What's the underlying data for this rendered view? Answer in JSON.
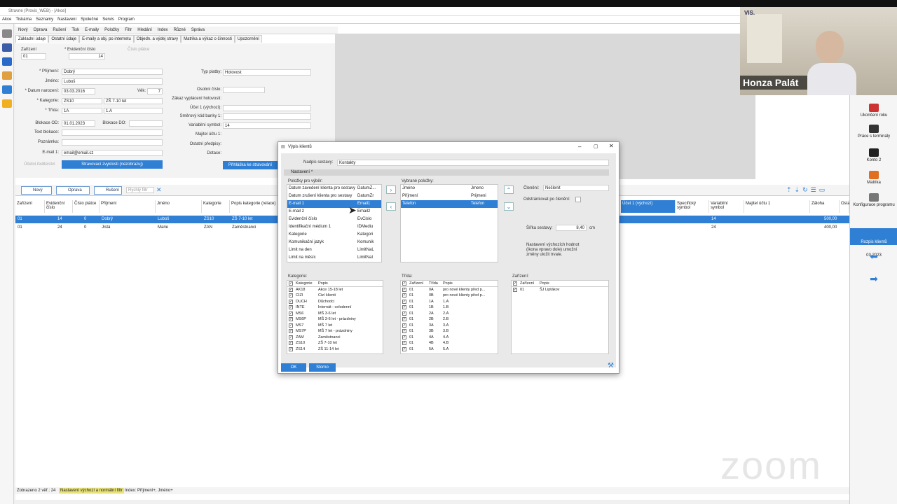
{
  "window": {
    "title": "Stravne (Provis_WEB) - [Akce]"
  },
  "menu": [
    "Akce",
    "Tiskárna",
    "Seznamy",
    "Nastavení",
    "Společné",
    "Servis",
    "Program"
  ],
  "commands": [
    "Nový",
    "Oprava",
    "Rušení",
    "Tisk",
    "E-maily",
    "Položky",
    "Filtr",
    "Hledání",
    "Index",
    "Různé",
    "Správa"
  ],
  "tabs": [
    "Základní údaje",
    "Ostatní údaje",
    "E-maily a obj. po internetu",
    "Objedn. a výdej stravy",
    "Matrika a výkaz o činnosti",
    "Upozornění"
  ],
  "form": {
    "zarizeni_label": "Zařízení",
    "zarizeni": "01",
    "evid_label": "* Evidenční číslo",
    "evid": "14",
    "cislo_platce": "Číslo plátce",
    "prijmeni_label": "* Příjmení:",
    "prijmeni": "Dobrý",
    "jmeno_label": "Jméno:",
    "jmeno": "Luboš",
    "datum_label": "* Datum narození:",
    "datum": "03.03.2016",
    "vek_label": "Věk:",
    "vek": "7",
    "kategorie_label": "* Kategorie:",
    "kategorie": "ZS10",
    "kategorie_popis": "ZŠ 7-10 let",
    "trida_label": "* Třída:",
    "trida": "1A",
    "trida_popis": "1.A",
    "blok_od_label": "Blokace OD:",
    "blok_od": "01.01.2023",
    "blok_do_label": "Blokace DO:",
    "text_blok_label": "Text blokace:",
    "poznamka_label": "Poznámka:",
    "email_label": "E-mail 1:",
    "email": "email@email.cz",
    "stravovaci_btn": "Stravovací zvyklosti (nezobrazuj)",
    "hidden_cb": "Účetní ředitelství",
    "typ_platby_label": "Typ platby:",
    "typ_platby": "Hotovost",
    "osobni_label": "Osobní číslo:",
    "zakaz_label": "Zákaz vyplácení hotovosti:",
    "ucet_label": "Účet 1 (výchozí):",
    "smerovy_label": "Směrový kód banky 1:",
    "var_label": "Variabilní symbol:",
    "var": "14",
    "majitel_label": "Majitel účtu 1:",
    "ostatni_label": "Ostatní předpisy:",
    "dotace_label": "Dotace:",
    "prihlaska_btn": "Přihláška ke stravování"
  },
  "rowbar": {
    "new": "Nový",
    "edit": "Oprava",
    "delete": "Rušení",
    "filter": "Rychlý filtr"
  },
  "grid": {
    "headers": [
      "Zařízení",
      "Evidenční číslo",
      "Číslo plátce",
      "Příjmení",
      "Jméno",
      "Kategorie",
      "Popis kategorie (relace)",
      "Účet 1 (výchozí)",
      "Specifický symbol",
      "Variabilní symbol",
      "Majitel účtu 1",
      "Záloha",
      "Ostatní"
    ],
    "rows": [
      [
        "01",
        "14",
        "0",
        "Dobrý",
        "Luboš",
        "ZS10",
        "ZŠ 7-10 let",
        "14",
        "500,00"
      ],
      [
        "01",
        "24",
        "0",
        "Jistá",
        "Marie",
        "ZAN",
        "Zaměstnanci",
        "24",
        "400,00"
      ]
    ]
  },
  "status": {
    "count": "Zobrazeno 2 věř.: 24",
    "filter": "Nastavení výchozí a normální filtr",
    "index": "Index: Příjmení+, Jméno+"
  },
  "camera": {
    "name": "Honza Palát",
    "brand": "VIS."
  },
  "rightpanel": [
    {
      "label": "Ukončení roku"
    },
    {
      "label": "Práce s terminály"
    },
    {
      "label": "Konto 2"
    },
    {
      "label": "Matrika"
    },
    {
      "label": "Konfigurace programu"
    },
    {
      "label": "Rozpis klientů"
    },
    {
      "label": "03.2023"
    }
  ],
  "dialog": {
    "title": "Výpis klientů",
    "nadpis_label": "Nadpis sestavy:",
    "nadpis": "Kontakty",
    "nastaveni": "Nastavení",
    "avail_label": "Položky pro výběr:",
    "available": [
      [
        "Datum zavedení klienta pro sestavy",
        "DatumZ..."
      ],
      [
        "Datum zrušení klienta pro sestavy",
        "DatumZr"
      ],
      [
        "E-mail 1",
        "Email1"
      ],
      [
        "E-mail 2",
        "Email2"
      ],
      [
        "Evidenční číslo",
        "EvCislo"
      ],
      [
        "Identifikační médium 1",
        "IDMediu"
      ],
      [
        "Kategorie",
        "Kategori"
      ],
      [
        "Komunikační jazyk",
        "Komunik"
      ],
      [
        "Limit na den",
        "LimitNaL"
      ],
      [
        "Limit na měsíc",
        "LimitNaI"
      ]
    ],
    "sel_label": "Vybrané položky:",
    "selected": [
      [
        "Jméno",
        "Jmeno"
      ],
      [
        "Příjmení",
        "Prijmeni"
      ],
      [
        "Telefon",
        "Telefon"
      ]
    ],
    "cleneni_label": "Členění:",
    "cleneni": "Nečlenit",
    "odstrankovat": "Odstránkovat po členění:",
    "sirka_label": "Šířka sestavy:",
    "sirka": "8,40",
    "sirka_unit": "cm",
    "note": "Nastavení výchozích hodnot (ikona vpravo dole) umožní změny uložit trvale.",
    "kat_label": "Kategorie:",
    "kat_headers": [
      "Kategorie",
      "Popis"
    ],
    "kat": [
      [
        "AK18",
        "Akce 15-18 let"
      ],
      [
        "CIZI",
        "Cizí klienti"
      ],
      [
        "DUCH",
        "Důchodci"
      ],
      [
        "INTE",
        "Internát - celodenní"
      ],
      [
        "MS6",
        "MŠ 3-6 let"
      ],
      [
        "MS6P",
        "MŠ 3-6 let - prázdniny"
      ],
      [
        "MS7",
        "MŠ 7 let"
      ],
      [
        "MS7P",
        "MŠ 7 let - prázdniny"
      ],
      [
        "ZAM",
        "Zaměstnanci"
      ],
      [
        "ZS10",
        "ZŠ 7-10 let"
      ],
      [
        "ZS14",
        "ZŠ 11-14 let"
      ]
    ],
    "tr_label": "Třída:",
    "tr_headers": [
      "Zařízení",
      "Třída",
      "Popis"
    ],
    "tridy": [
      [
        "01",
        "0A",
        "pro nové klienty před p..."
      ],
      [
        "01",
        "0B",
        "pro nové klienty před p..."
      ],
      [
        "01",
        "1A",
        "1.A"
      ],
      [
        "01",
        "1B",
        "1.B"
      ],
      [
        "01",
        "2A",
        "2.A"
      ],
      [
        "01",
        "2B",
        "2.B"
      ],
      [
        "01",
        "3A",
        "3.A"
      ],
      [
        "01",
        "3B",
        "3.B"
      ],
      [
        "01",
        "4A",
        "4.A"
      ],
      [
        "01",
        "4B",
        "4.B"
      ],
      [
        "01",
        "5A",
        "5.A"
      ]
    ],
    "zar_label": "Zařízení:",
    "zar_headers": [
      "Zařízení",
      "Popis"
    ],
    "zar": [
      [
        "01",
        "ŠJ Liptákov"
      ]
    ],
    "ok": "OK",
    "storno": "Storno"
  },
  "zoom": "zoom",
  "colors": {
    "accent": "#2f7fd4",
    "selection": "#2f7fd4"
  }
}
